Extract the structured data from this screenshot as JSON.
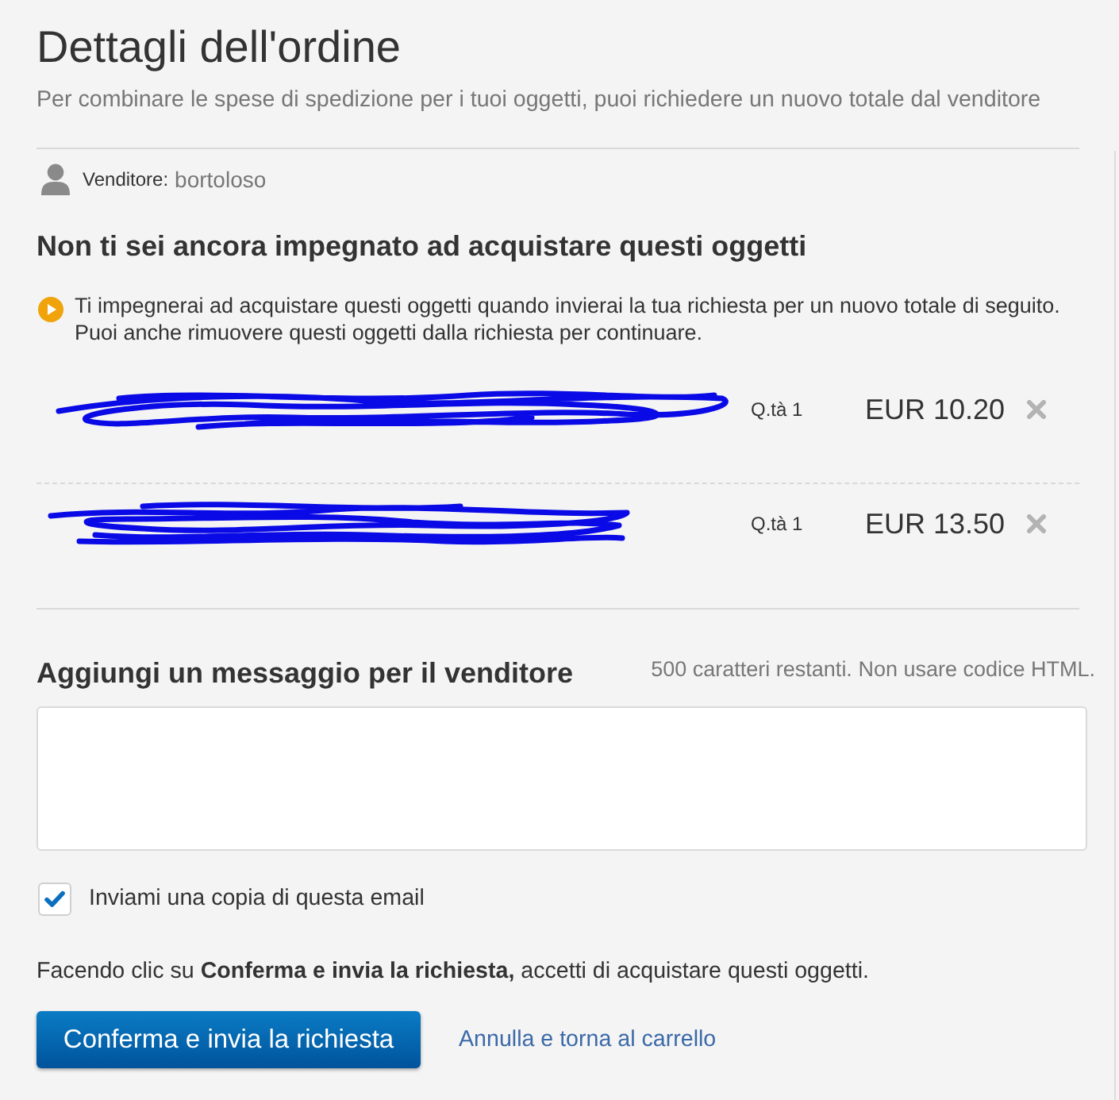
{
  "page": {
    "title": "Dettagli dell'ordine",
    "subtitle": "Per combinare le spese di spedizione per i tuoi oggetti, puoi richiedere un nuovo totale dal venditore"
  },
  "seller": {
    "label": "Venditore:",
    "name": "bortoloso"
  },
  "commitment": {
    "heading": "Non ti sei ancora impegnato ad acquistare questi oggetti",
    "notice": "Ti impegnerai ad acquistare questi oggetti quando invierai la tua richiesta per un nuovo totale di seguito. Puoi anche rimuovere questi oggetti dalla richiesta per continuare."
  },
  "items": [
    {
      "quantity": "Q.tà 1",
      "price": "EUR 10.20"
    },
    {
      "quantity": "Q.tà 1",
      "price": "EUR 13.50"
    }
  ],
  "message": {
    "heading": "Aggiungi un messaggio per il venditore",
    "hint": "500 caratteri restanti. Non usare codice HTML."
  },
  "copy_email": {
    "label": "Inviami una copia di questa email",
    "checked": true
  },
  "consent": "Facendo clic su **Conferma e invia la richiesta,** accetti di acquistare questi oggetti.",
  "actions": {
    "confirm": "Conferma e invia la richiesta",
    "cancel": "Annulla e torna al carrello"
  }
}
